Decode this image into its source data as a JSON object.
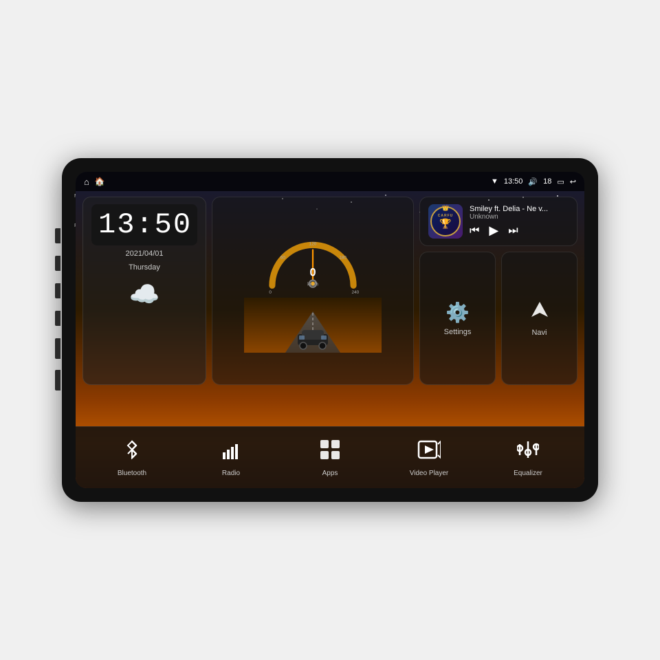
{
  "device": {
    "title": "Car Head Unit"
  },
  "status_bar": {
    "wifi_icon": "▾",
    "time": "13:50",
    "volume_icon": "🔊",
    "volume_level": "18",
    "window_icon": "▭",
    "back_icon": "↩",
    "home_icon": "⌂",
    "nav_icon": "⌂"
  },
  "clock": {
    "time": "13:50",
    "date": "2021/04/01",
    "day": "Thursday"
  },
  "speedometer": {
    "speed": "0",
    "unit": "km/h"
  },
  "music": {
    "track_title": "Smiley ft. Delia - Ne v...",
    "artist": "Unknown"
  },
  "buttons": {
    "settings_label": "Settings",
    "navi_label": "Navi"
  },
  "bottom_bar": [
    {
      "id": "bluetooth",
      "label": "Bluetooth",
      "icon": "bluetooth"
    },
    {
      "id": "radio",
      "label": "Radio",
      "icon": "radio"
    },
    {
      "id": "apps",
      "label": "Apps",
      "icon": "apps"
    },
    {
      "id": "video_player",
      "label": "Video Player",
      "icon": "video"
    },
    {
      "id": "equalizer",
      "label": "Equalizer",
      "icon": "equalizer"
    }
  ],
  "side_labels": {
    "mic": "MIC",
    "rst": "RST"
  }
}
